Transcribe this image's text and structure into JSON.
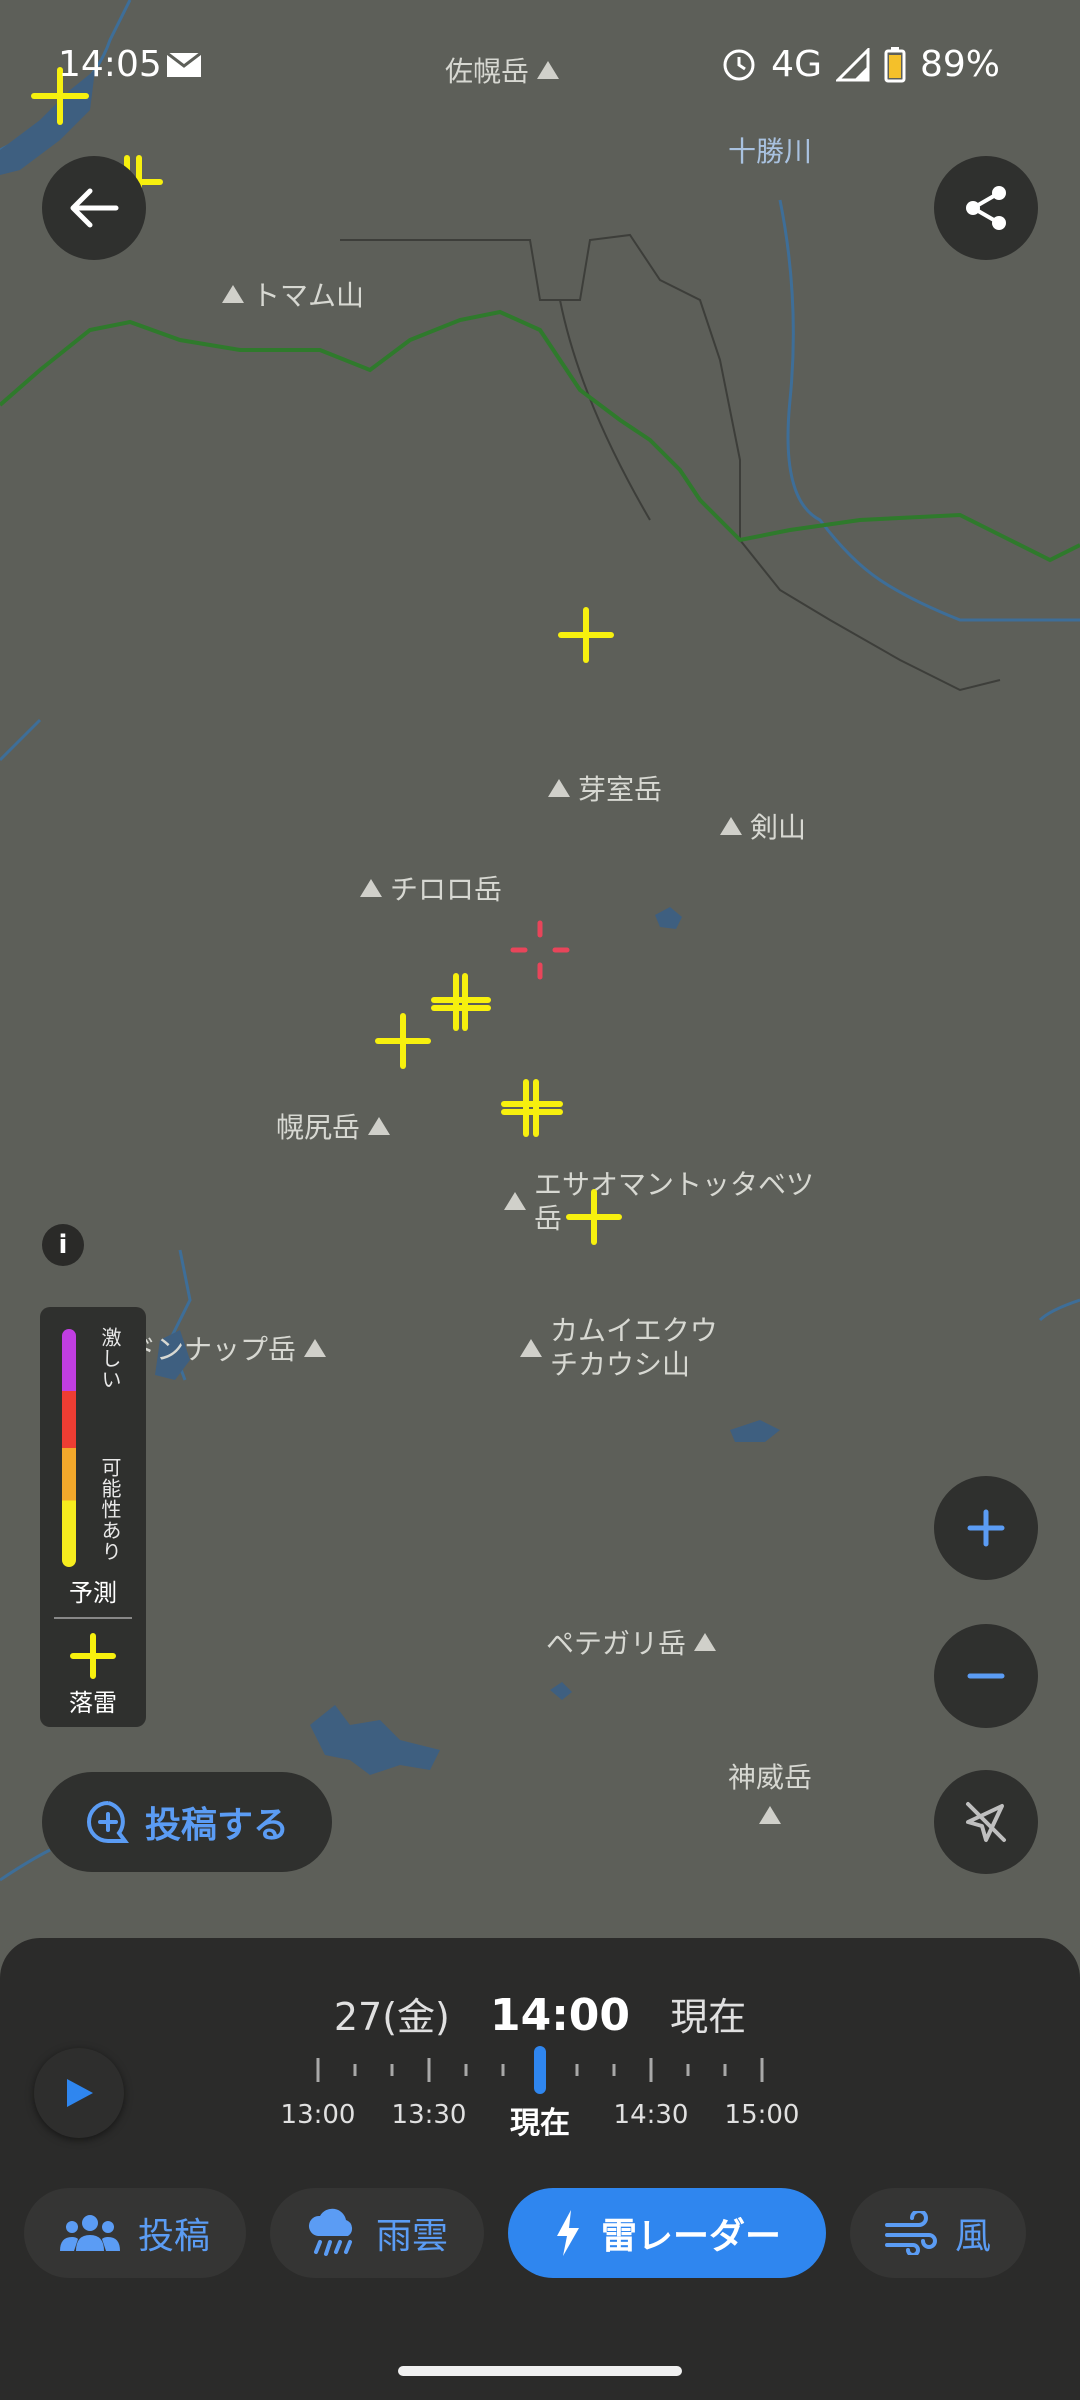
{
  "status_bar": {
    "time": "14:05",
    "network": "4G",
    "battery": "89%"
  },
  "map": {
    "places": [
      {
        "name": "佐幌岳",
        "icon": "mountain-icon"
      },
      {
        "name": "十勝川",
        "icon": ""
      },
      {
        "name": "トマム山",
        "icon": "mountain-icon"
      },
      {
        "name": "芽室岳",
        "icon": "mountain-icon"
      },
      {
        "name": "剣山",
        "icon": "mountain-icon"
      },
      {
        "name": "チロロ岳",
        "icon": "mountain-icon"
      },
      {
        "name": "幌尻岳",
        "icon": "mountain-icon"
      },
      {
        "name": "エサオマントッタベツ",
        "line2": "岳",
        "icon": "mountain-icon"
      },
      {
        "name": "ドンナップ岳",
        "icon": "mountain-icon"
      },
      {
        "name": "カムイエクウ",
        "line2": "チカウシ山",
        "icon": "mountain-icon"
      },
      {
        "name": "ペテガリ岳",
        "icon": "mountain-icon"
      },
      {
        "name": "神威岳",
        "icon": "mountain-icon"
      }
    ],
    "lightning_color": "#f7f00e",
    "current_location_color": "#e8455a"
  },
  "legend": {
    "intense_label": "激しい",
    "possible_label": "可能性あり",
    "forecast_label": "予測",
    "strike_label": "落雷",
    "colors": [
      "#c13ee2",
      "#ee3d33",
      "#f3a82b",
      "#f6ec1e"
    ]
  },
  "post_button": {
    "label": "投稿する"
  },
  "timeline": {
    "date": "27(金)",
    "time": "14:00",
    "now_label": "現在",
    "ticks": [
      "13:00",
      "13:30",
      "現在",
      "14:30",
      "15:00"
    ]
  },
  "nav": {
    "posts": "投稿",
    "rain": "雨雲",
    "lightning": "雷レーダー",
    "wind": "風"
  },
  "colors": {
    "accent": "#2f86ef",
    "accent_text": "#5b9cf4"
  }
}
